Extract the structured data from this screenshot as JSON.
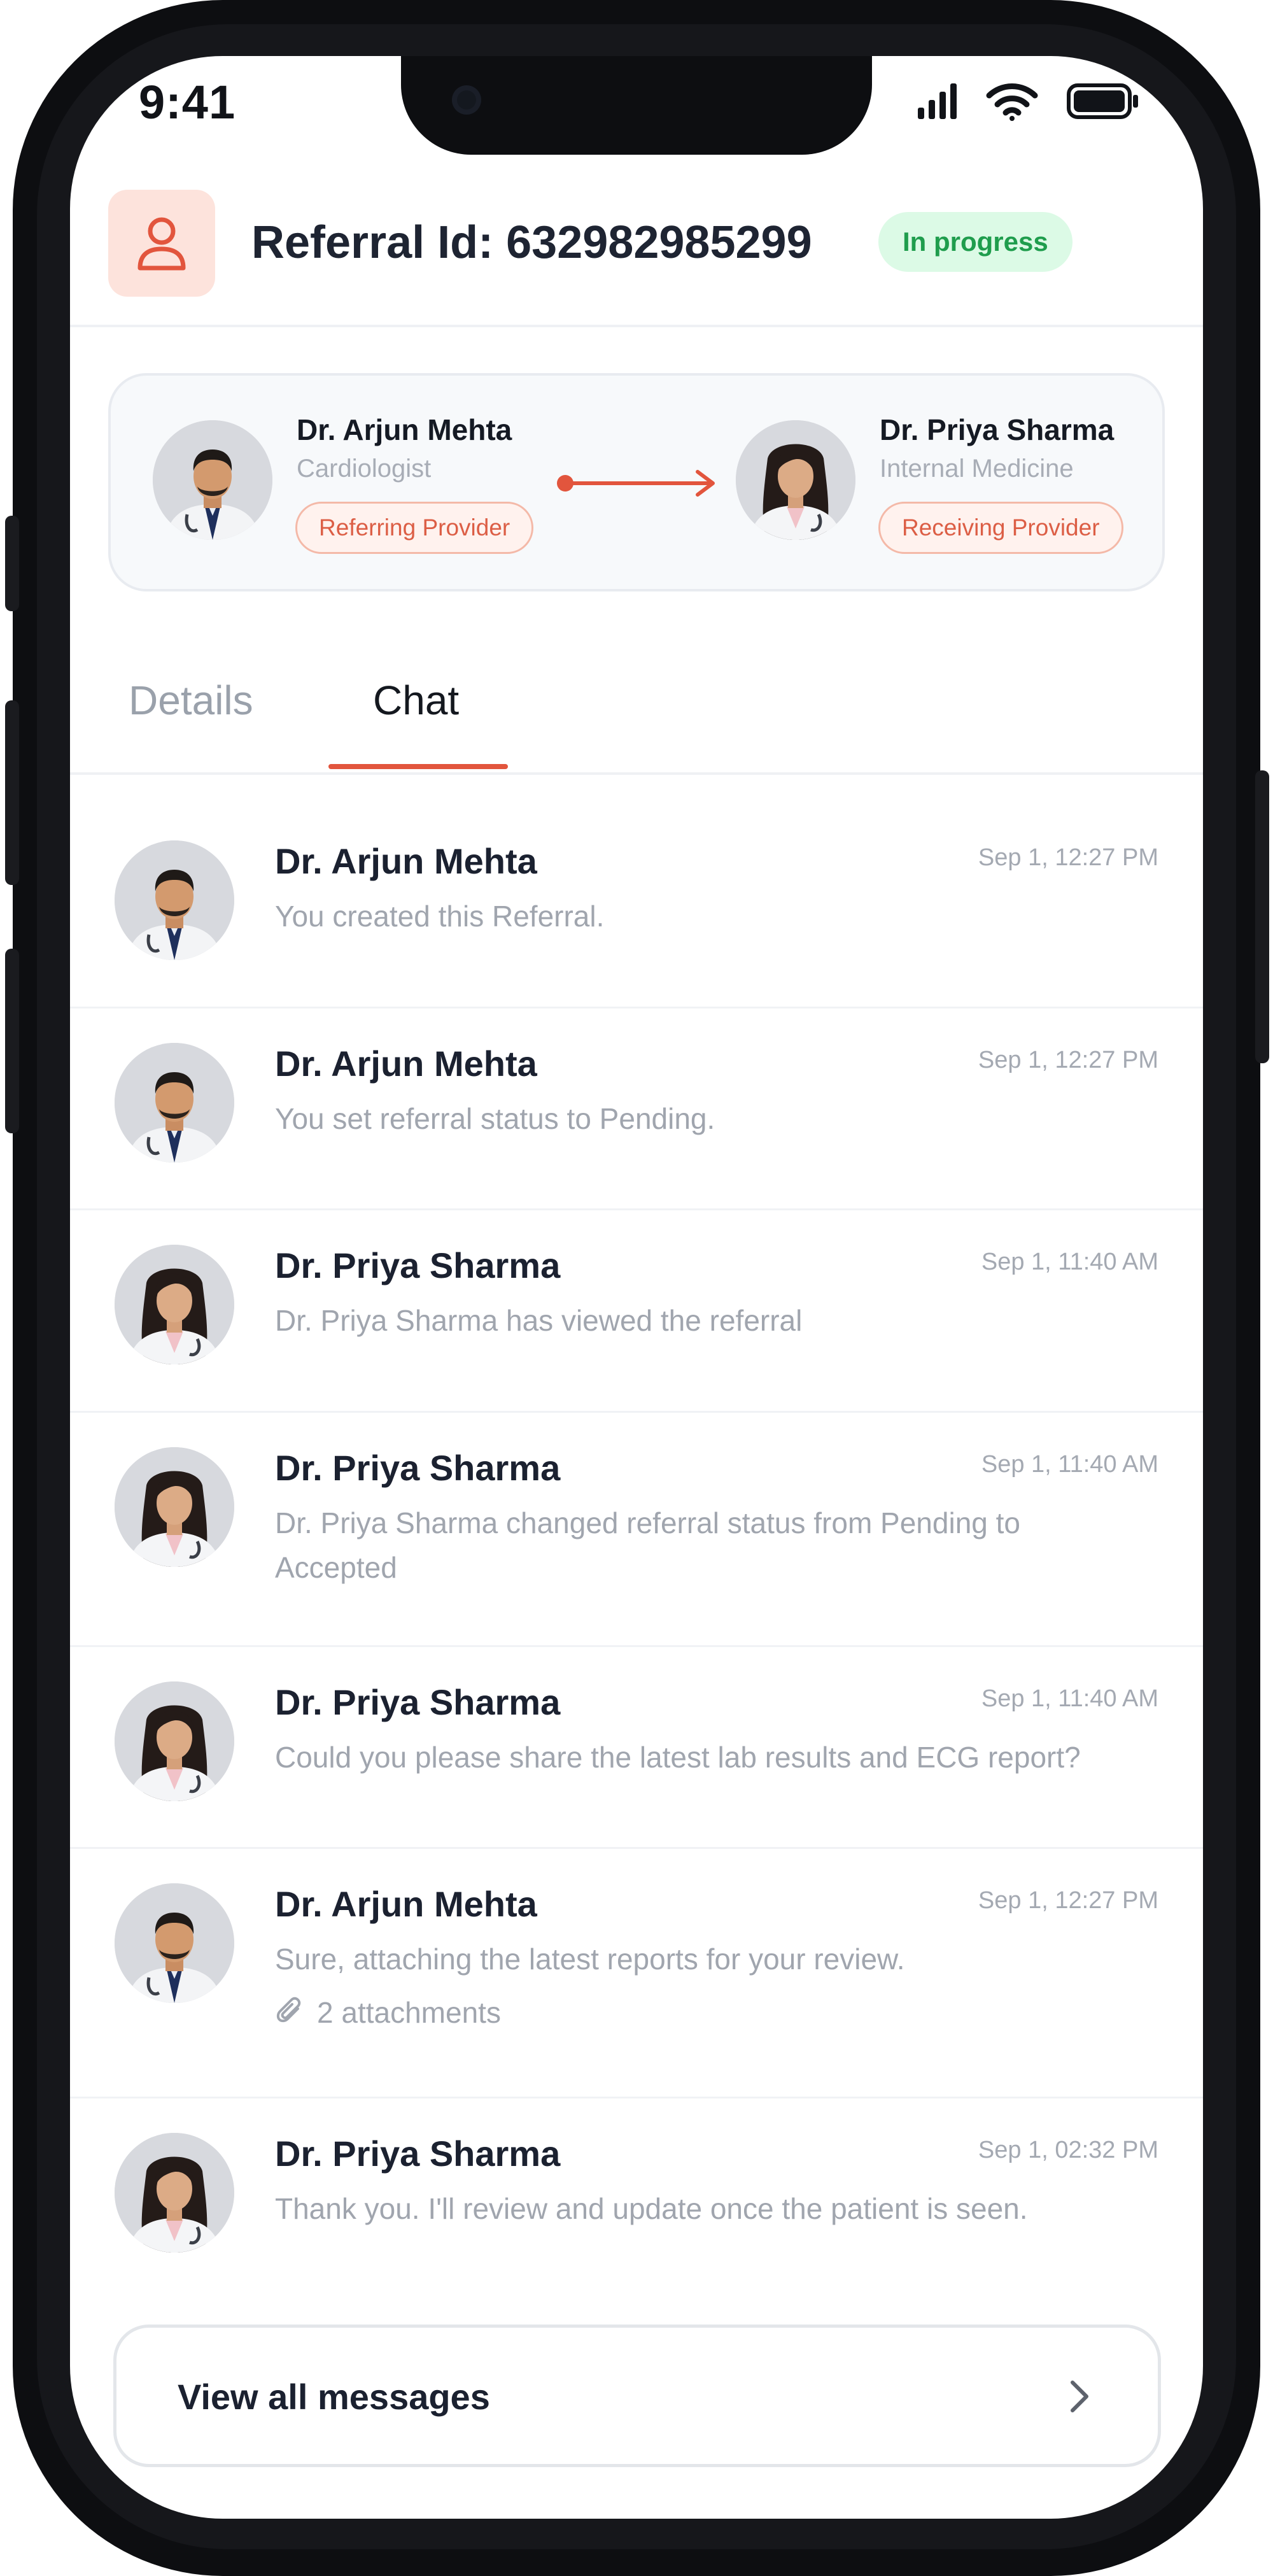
{
  "status_bar": {
    "time": "9:41"
  },
  "header": {
    "referral_label": "Referral Id: 632982985299",
    "status": "In progress",
    "status_color": "#1f9d4d"
  },
  "providers": {
    "referring": {
      "name": "Dr. Arjun Mehta",
      "specialty": "Cardiologist",
      "role": "Referring Provider"
    },
    "receiving": {
      "name": "Dr. Priya Sharma",
      "specialty": "Internal Medicine",
      "role": "Receiving Provider"
    }
  },
  "tabs": [
    {
      "label": "Details",
      "active": false
    },
    {
      "label": "Chat",
      "active": true
    }
  ],
  "messages": [
    {
      "sender": "Dr. Arjun Mehta",
      "avatar": "male-doctor",
      "time": "Sep 1, 12:27 PM",
      "text": "You created this Referral."
    },
    {
      "sender": "Dr. Arjun Mehta",
      "avatar": "male-doctor",
      "time": "Sep 1, 12:27 PM",
      "text": "You set referral status to Pending."
    },
    {
      "sender": "Dr. Priya Sharma",
      "avatar": "female-doctor",
      "time": "Sep 1, 11:40 AM",
      "text": "Dr. Priya Sharma has viewed the referral"
    },
    {
      "sender": "Dr. Priya Sharma",
      "avatar": "female-doctor",
      "time": "Sep 1, 11:40 AM",
      "text": "Dr. Priya Sharma changed referral status from Pending to Accepted"
    },
    {
      "sender": "Dr. Priya Sharma",
      "avatar": "female-doctor",
      "time": "Sep 1, 11:40 AM",
      "text": "Could you please share the latest lab results and ECG report?"
    },
    {
      "sender": "Dr. Arjun Mehta",
      "avatar": "male-doctor",
      "time": "Sep 1, 12:27 PM",
      "text": "Sure, attaching the latest reports for your review.",
      "attachments": "2 attachments"
    },
    {
      "sender": "Dr. Priya Sharma",
      "avatar": "female-doctor",
      "time": "Sep 1, 02:32 PM",
      "text": "Thank you. I'll review and update once the patient is seen."
    }
  ],
  "view_all": {
    "label": "View all messages"
  },
  "colors": {
    "accent": "#e2553d",
    "tag_bg": "#fff2ee",
    "status_bg": "#dcfae6"
  },
  "icons": [
    "person-icon",
    "signal-icon",
    "wifi-icon",
    "battery-icon",
    "arrow-right-icon",
    "paperclip-icon",
    "chevron-right-icon"
  ]
}
